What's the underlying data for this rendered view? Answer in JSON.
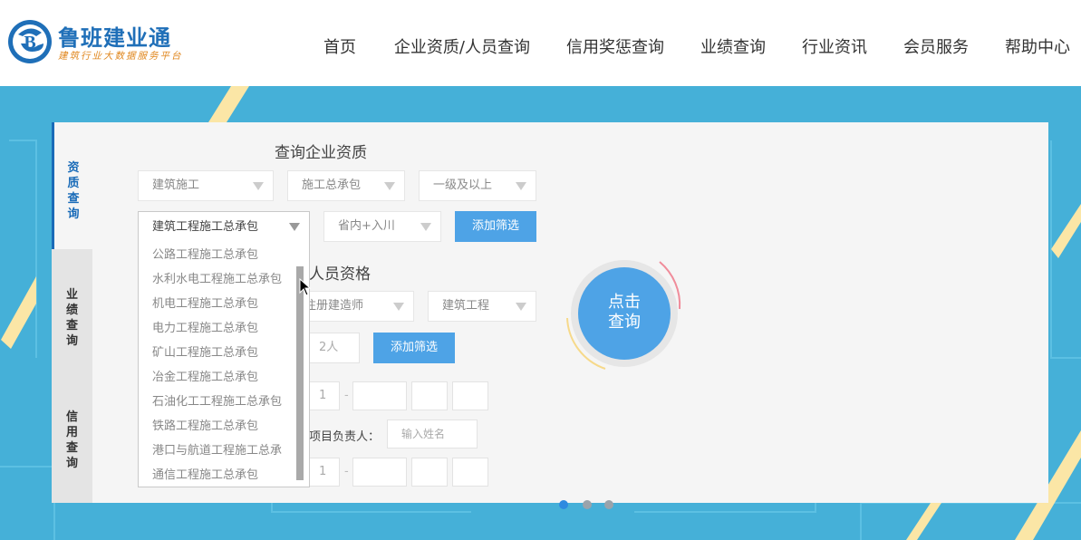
{
  "brand": {
    "name": "鲁班建业通",
    "tagline": "建筑行业大数据服务平台",
    "colors": {
      "primary": "#1f6fb8",
      "accent": "#e0871e"
    }
  },
  "nav": {
    "items": [
      "首页",
      "企业资质/人员查询",
      "信用奖惩查询",
      "业绩查询",
      "行业资讯",
      "会员服务",
      "帮助中心"
    ]
  },
  "side_tabs": {
    "active": "资质查询",
    "items": [
      "资质查询",
      "业绩查询",
      "信用查询"
    ]
  },
  "qualification": {
    "title": "查询企业资质",
    "select_category": "建筑施工",
    "select_type": "施工总承包",
    "select_level": "一级及以上",
    "select_region": "省内+入川",
    "add_filter": "添加筛选"
  },
  "dropdown": {
    "selected": "建筑工程施工总承包",
    "options": [
      "公路工程施工总承包",
      "水利水电工程施工总承包",
      "机电工程施工总承包",
      "电力工程施工总承包",
      "矿山工程施工总承包",
      "冶金工程施工总承包",
      "石油化工工程施工总承包",
      "铁路工程施工总承包",
      "港口与航道工程施工总承",
      "通信工程施工总承包"
    ]
  },
  "personnel": {
    "title": "人员资格",
    "select_cert": "注册建造师",
    "select_major": "建筑工程",
    "count": "2人",
    "add_filter": "添加筛选",
    "range_a_start": "1",
    "range_sep": "-",
    "manager_label": "项目负责人：",
    "manager_placeholder": "输入姓名",
    "range_b_start": "1"
  },
  "search_button": {
    "line1": "点击",
    "line2": "查询"
  },
  "carousel": {
    "active_index": 1,
    "count": 3
  }
}
